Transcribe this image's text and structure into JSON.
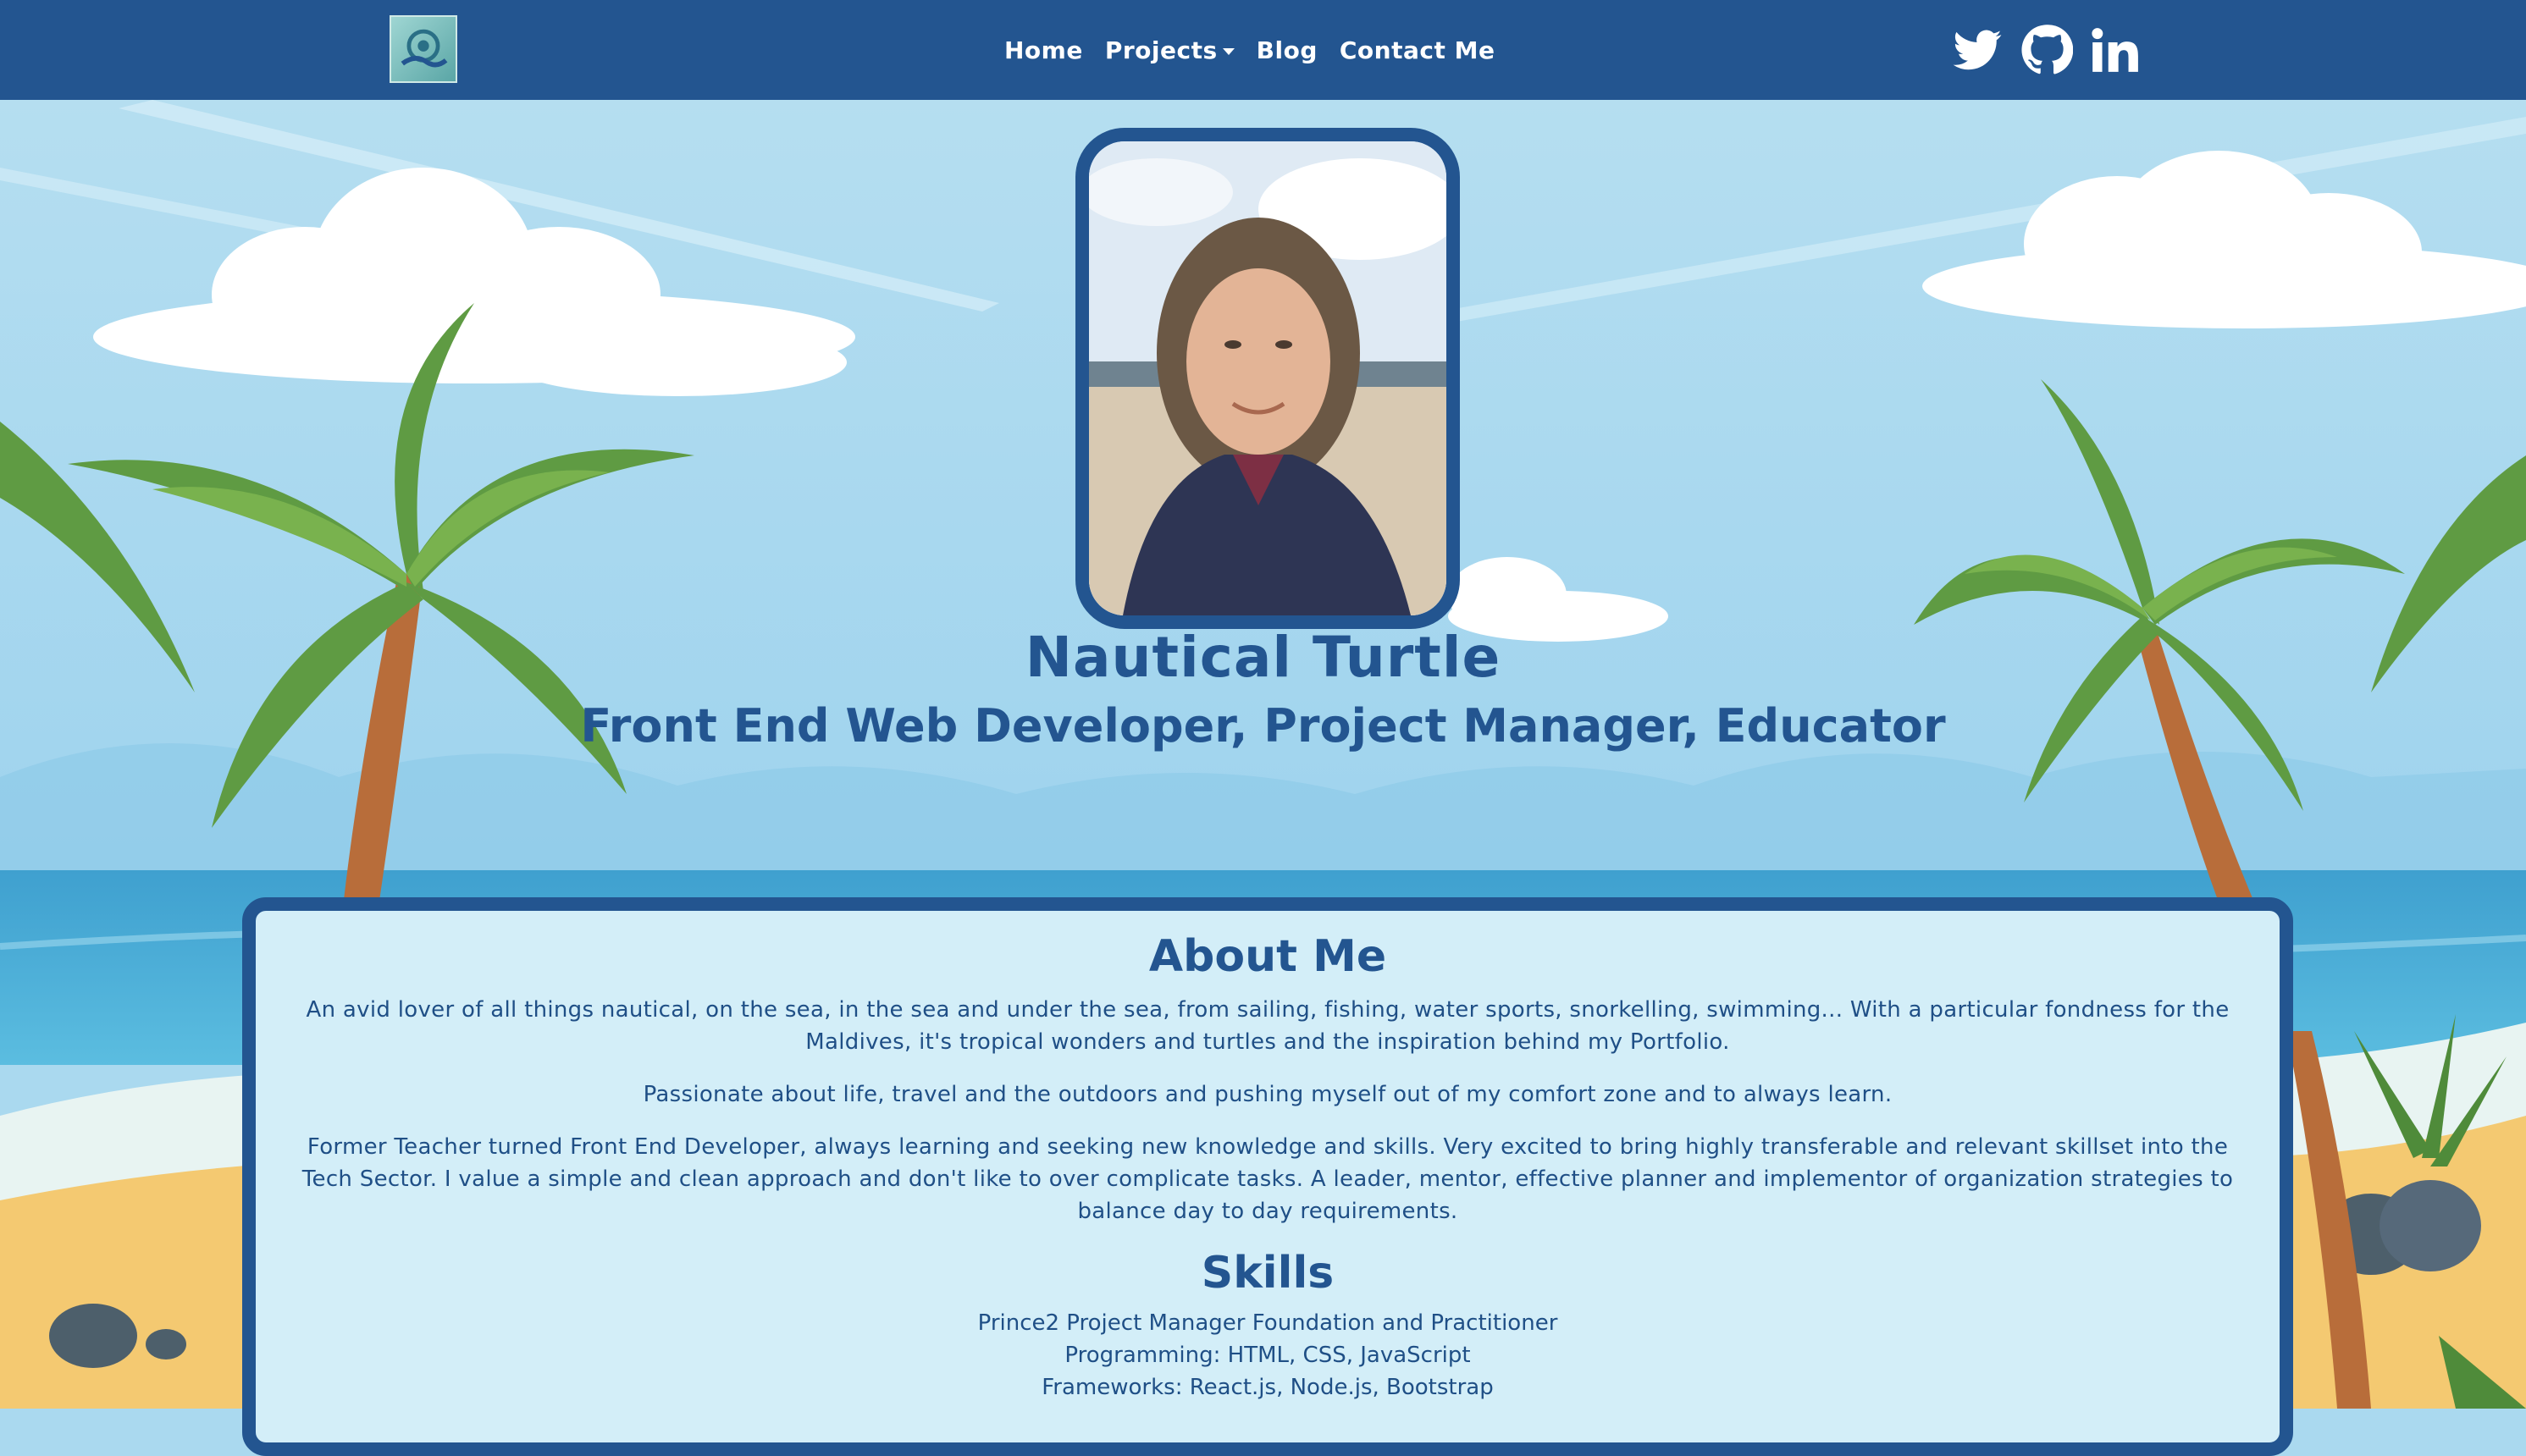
{
  "nav": {
    "logo_alt": "turtle-logo",
    "links": [
      {
        "label": "Home"
      },
      {
        "label": "Projects"
      },
      {
        "label": "Blog"
      },
      {
        "label": "Contact Me"
      }
    ],
    "social": [
      "twitter-icon",
      "github-icon",
      "linkedin-icon"
    ]
  },
  "hero": {
    "name": "Nautical Turtle",
    "subtitle": "Front End Web Developer, Project Manager, Educator"
  },
  "about": {
    "title": "About Me",
    "paragraphs": [
      "An avid lover of all things nautical, on the sea, in the sea and under the sea, from sailing, fishing, water sports, snorkelling, swimming... With a particular fondness for the Maldives, it's tropical wonders and turtles and the inspiration behind my Portfolio.",
      "Passionate about life, travel and the outdoors and pushing myself out of my comfort zone and to always learn.",
      "Former Teacher turned Front End Developer, always learning and seeking new knowledge and skills. Very excited to bring highly transferable and relevant skillset into the Tech Sector. I value a simple and clean approach and don't like to over complicate tasks. A leader, mentor, effective planner and implementor of organization strategies to balance day to day requirements."
    ],
    "skills_title": "Skills",
    "skills": [
      "Prince2 Project Manager Foundation and Practitioner",
      "Programming: HTML, CSS, JavaScript",
      "Frameworks: React.js, Node.js, Bootstrap"
    ]
  },
  "colors": {
    "navbar": "#235590",
    "text_dark": "#235590",
    "card_bg": "#d3eef8",
    "sky": "#aad9ef"
  }
}
